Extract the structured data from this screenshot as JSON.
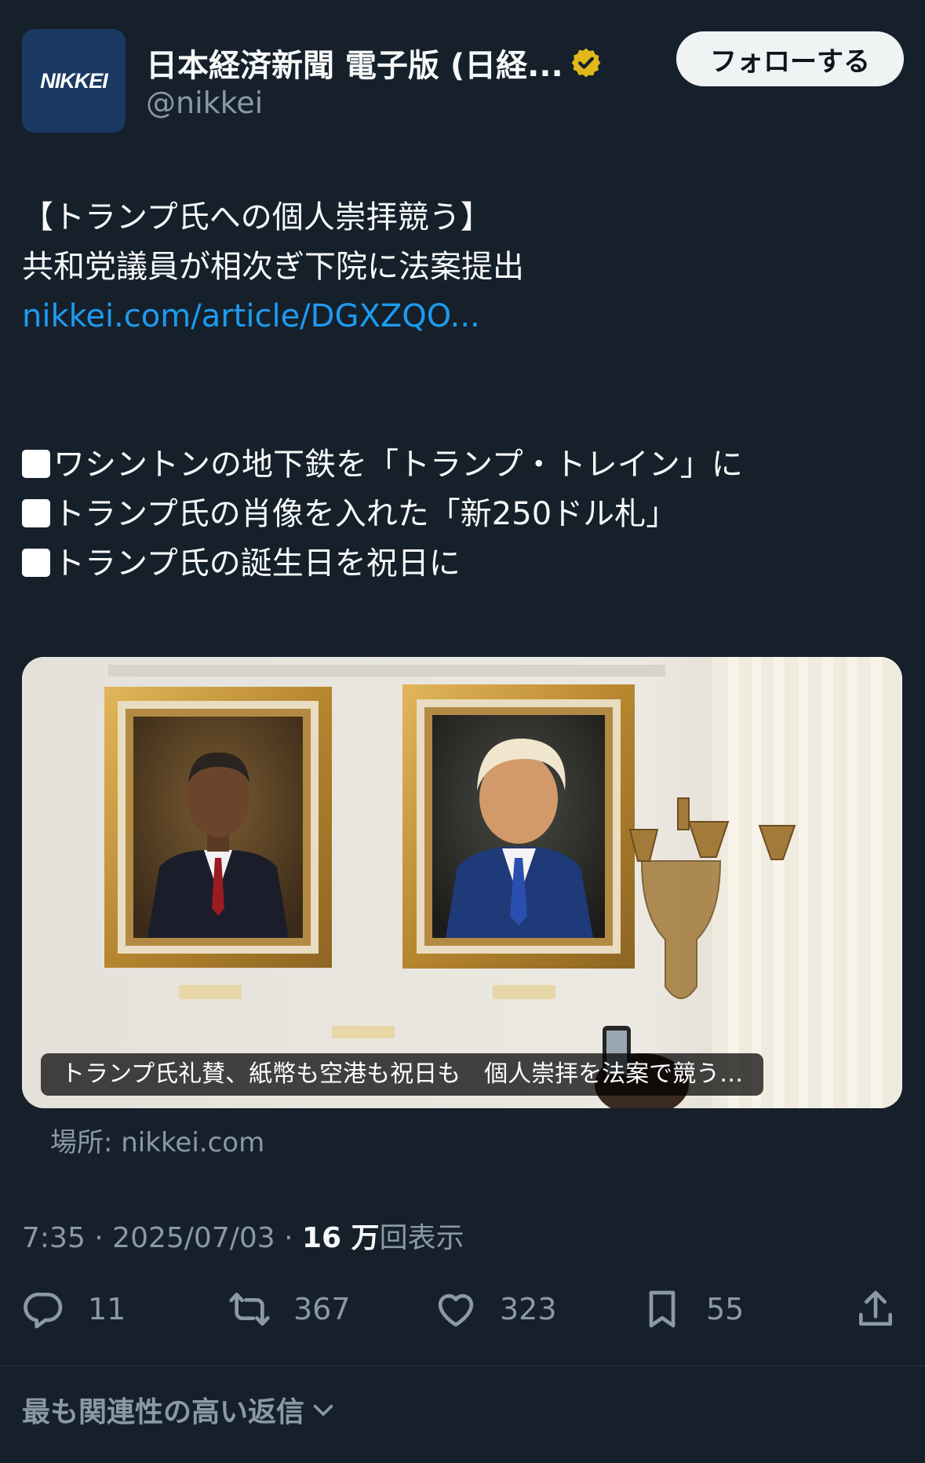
{
  "account": {
    "logo_text": "NIKKEI",
    "name": "日本経済新聞 電子版 (日経...",
    "handle": "@nikkei",
    "follow_label": "フォローする"
  },
  "tweet": {
    "line1": "【トランプ氏への個人崇拝競う】",
    "line2": "共和党議員が相次ぎ下院に法案提出",
    "link": "nikkei.com/article/DGXZQO...",
    "bullet1": "ワシントンの地下鉄を「トランプ・トレイン」に",
    "bullet2": "トランプ氏の肖像を入れた「新250ドル札」",
    "bullet3": "トランプ氏の誕生日を祝日に"
  },
  "card": {
    "caption": "トランプ氏礼賛、紙幣も空港も祝日も　個人崇拝を法案で競う…",
    "source": "場所: nikkei.com"
  },
  "meta": {
    "time_date": "7:35 · 2025/07/03 · ",
    "views_count": "16 万",
    "views_label": "回表示"
  },
  "actions": {
    "replies": "11",
    "retweets": "367",
    "likes": "323",
    "bookmarks": "55"
  },
  "footer": {
    "relevant_replies": "最も関連性の高い返信"
  },
  "colors": {
    "background": "#15202b",
    "link": "#1d9bf0",
    "muted": "#8b98a5",
    "verified_badge": "#e2b719"
  }
}
